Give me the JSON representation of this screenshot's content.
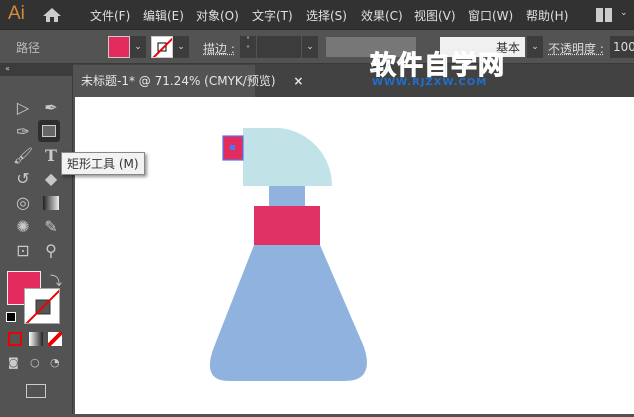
{
  "app": {
    "logo": "Ai"
  },
  "menu": [
    "文件(F)",
    "编辑(E)",
    "对象(O)",
    "文字(T)",
    "选择(S)",
    "效果(C)",
    "视图(V)",
    "窗口(W)",
    "帮助(H)"
  ],
  "control": {
    "object_type": "路径",
    "stroke_label": "描边 :",
    "style_label": "基本",
    "opacity_label": "不透明度 :",
    "opacity_value": "100",
    "fill_color": "#e32b5e"
  },
  "document": {
    "tab_title": "未标题-1* @ 71.24% (CMYK/预览)",
    "close": "×"
  },
  "tooltip": "矩形工具 (M)",
  "watermark": {
    "title": "软件自学网",
    "url": "WWW.RJZXW.COM"
  },
  "colors": {
    "cap": "#c1e3e8",
    "body": "#8fb3de",
    "collar": "#e13265",
    "nozzle": "#e32b5e",
    "selection": "#4a7bf0"
  }
}
